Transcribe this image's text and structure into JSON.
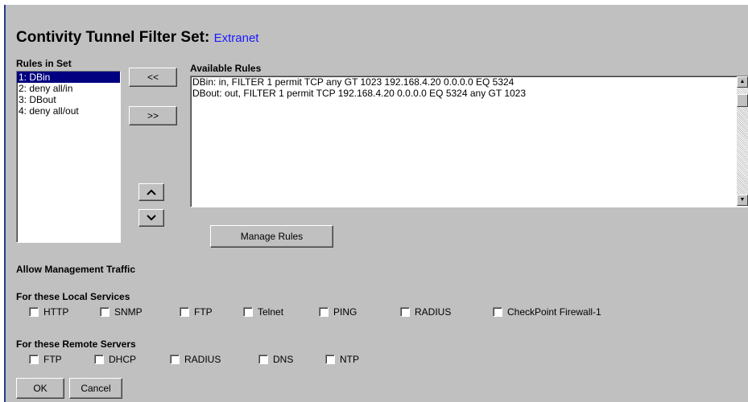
{
  "title": {
    "main": "Contivity Tunnel Filter Set:",
    "sub": "Extranet"
  },
  "rules_in_set": {
    "label": "Rules in Set",
    "items": [
      "1: DBin",
      "2: deny all/in",
      "3: DBout",
      "4: deny all/out"
    ],
    "selected_index": 0
  },
  "transfer_buttons": {
    "move_left": "<<",
    "move_right": ">>",
    "up": "^",
    "down": "v"
  },
  "available_rules": {
    "label": "Available Rules",
    "items": [
      "DBin: in, FILTER 1 permit TCP any GT 1023 192.168.4.20 0.0.0.0 EQ 5324",
      "DBout: out, FILTER 1 permit TCP 192.168.4.20 0.0.0.0 EQ 5324 any GT 1023"
    ]
  },
  "manage_rules_label": "Manage Rules",
  "management": {
    "heading": "Allow Management Traffic"
  },
  "local_services": {
    "heading": "For these Local Services",
    "items": [
      "HTTP",
      "SNMP",
      "FTP",
      "Telnet",
      "PING",
      "RADIUS",
      "CheckPoint Firewall-1"
    ]
  },
  "remote_servers": {
    "heading": "For these Remote Servers",
    "items": [
      "FTP",
      "DHCP",
      "RADIUS",
      "DNS",
      "NTP"
    ]
  },
  "footer": {
    "ok": "OK",
    "cancel": "Cancel"
  },
  "colors": {
    "panel": "#c0c0c0",
    "selection": "#000080",
    "accent_blue": "#1a1aff"
  }
}
